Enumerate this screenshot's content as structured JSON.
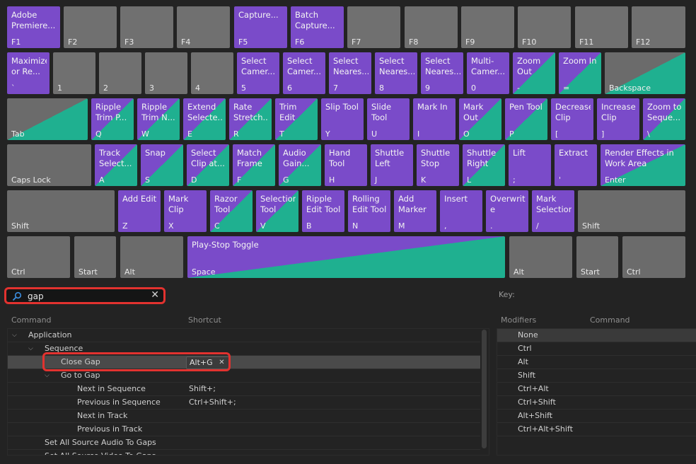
{
  "colors": {
    "application": "#7a4bc9",
    "panel": "#1fb090",
    "unassigned": "#707070",
    "highlight": "#e2322f"
  },
  "keyboard": {
    "row0": [
      {
        "cap": "F1",
        "label": "Adobe Premiere..."
      },
      {
        "cap": "F2",
        "label": ""
      },
      {
        "cap": "F3",
        "label": ""
      },
      {
        "cap": "F4",
        "label": ""
      },
      {
        "cap": "F5",
        "label": "Capture..."
      },
      {
        "cap": "F6",
        "label": "Batch Capture..."
      },
      {
        "cap": "F7",
        "label": ""
      },
      {
        "cap": "F8",
        "label": ""
      },
      {
        "cap": "F9",
        "label": ""
      },
      {
        "cap": "F10",
        "label": ""
      },
      {
        "cap": "F11",
        "label": ""
      },
      {
        "cap": "F12",
        "label": ""
      }
    ],
    "row1": [
      {
        "cap": "`",
        "label": "Maximize or Re..."
      },
      {
        "cap": "1",
        "label": ""
      },
      {
        "cap": "2",
        "label": ""
      },
      {
        "cap": "3",
        "label": ""
      },
      {
        "cap": "4",
        "label": ""
      },
      {
        "cap": "5",
        "label": "Select Camer..."
      },
      {
        "cap": "6",
        "label": "Select Camer..."
      },
      {
        "cap": "7",
        "label": "Select Neares..."
      },
      {
        "cap": "8",
        "label": "Select Neares..."
      },
      {
        "cap": "9",
        "label": "Select Neares..."
      },
      {
        "cap": "0",
        "label": "Multi-Camer..."
      },
      {
        "cap": "-",
        "label": "Zoom Out"
      },
      {
        "cap": "=",
        "label": "Zoom In"
      },
      {
        "cap": "Backspace",
        "label": ""
      }
    ],
    "row2": [
      {
        "cap": "Tab",
        "label": ""
      },
      {
        "cap": "Q",
        "label": "Ripple Trim P..."
      },
      {
        "cap": "W",
        "label": "Ripple Trim N..."
      },
      {
        "cap": "E",
        "label": "Extend Selecte..."
      },
      {
        "cap": "R",
        "label": "Rate Stretch..."
      },
      {
        "cap": "T",
        "label": "Trim Edit"
      },
      {
        "cap": "Y",
        "label": "Slip Tool"
      },
      {
        "cap": "U",
        "label": "Slide Tool"
      },
      {
        "cap": "I",
        "label": "Mark In"
      },
      {
        "cap": "O",
        "label": "Mark Out"
      },
      {
        "cap": "P",
        "label": "Pen Tool"
      },
      {
        "cap": "[",
        "label": "Decrease Clip Vo..."
      },
      {
        "cap": "]",
        "label": "Increase Clip Vo..."
      },
      {
        "cap": "\\",
        "label": "Zoom to Seque..."
      }
    ],
    "row3": [
      {
        "cap": "Caps Lock",
        "label": ""
      },
      {
        "cap": "A",
        "label": "Track Select..."
      },
      {
        "cap": "S",
        "label": "Snap"
      },
      {
        "cap": "D",
        "label": "Select Clip at..."
      },
      {
        "cap": "F",
        "label": "Match Frame"
      },
      {
        "cap": "G",
        "label": "Audio Gain..."
      },
      {
        "cap": "H",
        "label": "Hand Tool"
      },
      {
        "cap": "J",
        "label": "Shuttle Left"
      },
      {
        "cap": "K",
        "label": "Shuttle Stop"
      },
      {
        "cap": "L",
        "label": "Shuttle Right"
      },
      {
        "cap": ";",
        "label": "Lift"
      },
      {
        "cap": "'",
        "label": "Extract"
      },
      {
        "cap": "Enter",
        "label": "Render Effects in Work Area"
      }
    ],
    "row4": [
      {
        "cap": "Shift",
        "label": ""
      },
      {
        "cap": "Z",
        "label": "Add Edit"
      },
      {
        "cap": "X",
        "label": "Mark Clip"
      },
      {
        "cap": "C",
        "label": "Razor Tool"
      },
      {
        "cap": "V",
        "label": "Selection Tool"
      },
      {
        "cap": "B",
        "label": "Ripple Edit Tool"
      },
      {
        "cap": "N",
        "label": "Rolling Edit Tool"
      },
      {
        "cap": "M",
        "label": "Add Marker"
      },
      {
        "cap": ",",
        "label": "Insert"
      },
      {
        "cap": ".",
        "label": "Overwrite"
      },
      {
        "cap": "/",
        "label": "Mark Selection"
      },
      {
        "cap": "Shift",
        "label": ""
      }
    ],
    "row5": [
      {
        "cap": "Ctrl",
        "label": ""
      },
      {
        "cap": "Start",
        "label": ""
      },
      {
        "cap": "Alt",
        "label": ""
      },
      {
        "cap": "Space",
        "label": "Play-Stop Toggle"
      },
      {
        "cap": "Alt",
        "label": ""
      },
      {
        "cap": "Start",
        "label": ""
      },
      {
        "cap": "Ctrl",
        "label": ""
      }
    ]
  },
  "search": {
    "value": "gap",
    "icon": "search-icon"
  },
  "key_panel": {
    "label": "Key:"
  },
  "command_list": {
    "headers": {
      "command": "Command",
      "shortcut": "Shortcut"
    },
    "rows": [
      {
        "name": "Application",
        "shortcut": ""
      },
      {
        "name": "Sequence",
        "shortcut": ""
      },
      {
        "name": "Close Gap",
        "shortcut": "Alt+G"
      },
      {
        "name": "Go to Gap",
        "shortcut": ""
      },
      {
        "name": "Next in Sequence",
        "shortcut": "Shift+;"
      },
      {
        "name": "Previous in Sequence",
        "shortcut": "Ctrl+Shift+;"
      },
      {
        "name": "Next in Track",
        "shortcut": ""
      },
      {
        "name": "Previous in Track",
        "shortcut": ""
      },
      {
        "name": "Set All Source Audio To Gaps",
        "shortcut": ""
      },
      {
        "name": "Set All Source Video To Gaps",
        "shortcut": ""
      }
    ]
  },
  "modifiers": {
    "headers": {
      "modifiers": "Modifiers",
      "command": "Command"
    },
    "rows": [
      "None",
      "Ctrl",
      "Alt",
      "Shift",
      "Ctrl+Alt",
      "Ctrl+Shift",
      "Alt+Shift",
      "Ctrl+Alt+Shift"
    ]
  }
}
